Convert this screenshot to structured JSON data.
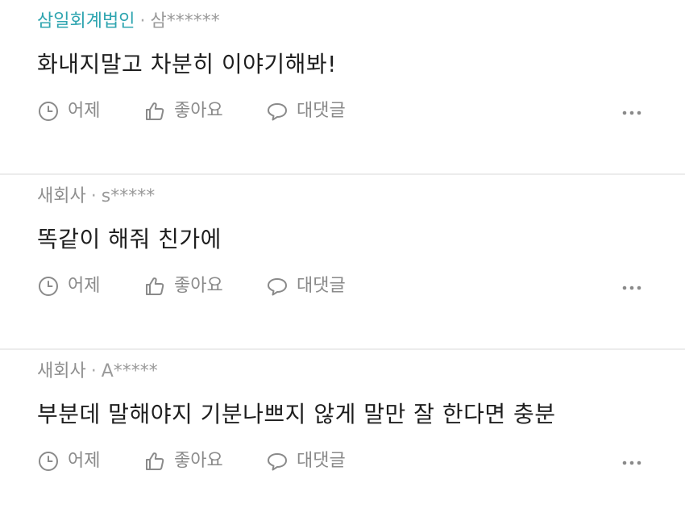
{
  "comments": [
    {
      "company": "삼일회계법인",
      "separator": "·",
      "user": "삼******",
      "text": "화내지말고 차분히 이야기해봐!",
      "time": "어제",
      "like_label": "좋아요",
      "reply_label": "대댓글"
    },
    {
      "company": "새회사",
      "separator": "·",
      "user": "s*****",
      "text": "똑같이 해줘 친가에",
      "time": "어제",
      "like_label": "좋아요",
      "reply_label": "대댓글"
    },
    {
      "company": "새회사",
      "separator": "·",
      "user": "A*****",
      "text": "부분데 말해야지 기분나쁘지 않게 말만 잘 한다면 충분",
      "time": "어제",
      "like_label": "좋아요",
      "reply_label": "대댓글"
    }
  ],
  "colors": {
    "accent_company": "#2fa5b0",
    "meta_gray": "#9a9a9a",
    "icon_gray": "#8a8a8a",
    "divider": "#ececec"
  },
  "icons": {
    "time": "clock-icon",
    "like": "thumbs-up-icon",
    "reply": "speech-bubble-icon",
    "more": "more-dots-icon"
  }
}
